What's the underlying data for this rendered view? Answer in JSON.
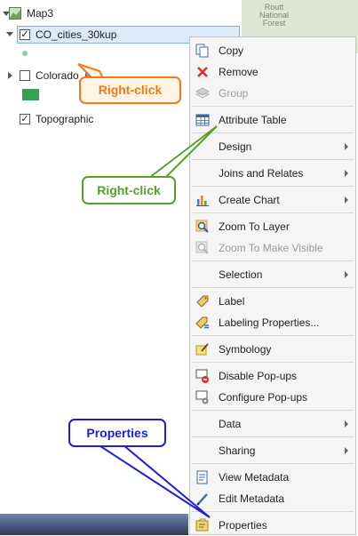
{
  "contents": {
    "map_name": "Map3",
    "layers": [
      {
        "name": "CO_cities_30kup",
        "checked": true
      },
      {
        "name": "Colorado_R"
      },
      {
        "name": "Topographic",
        "checked": true
      }
    ],
    "colors": {
      "selection": "#dbeaf8",
      "point_symbol": "#8cd19e",
      "polygon_symbol": "#3a9f55"
    }
  },
  "basemap_label": "Routt\nNational\nForest",
  "context_menu": {
    "items": [
      {
        "label": "Copy",
        "icon": "copy-icon",
        "enabled": true
      },
      {
        "label": "Remove",
        "icon": "remove-icon",
        "enabled": true
      },
      {
        "label": "Group",
        "icon": "group-icon",
        "enabled": false
      },
      {
        "label": "Attribute Table",
        "icon": "table-icon",
        "enabled": true
      },
      {
        "label": "Design",
        "submenu": true
      },
      {
        "label": "Joins and Relates",
        "submenu": true
      },
      {
        "label": "Create Chart",
        "icon": "chart-icon",
        "submenu": true
      },
      {
        "label": "Zoom To Layer",
        "icon": "zoom-icon",
        "enabled": true
      },
      {
        "label": "Zoom To Make Visible",
        "icon": "zoom-visible-icon",
        "enabled": false
      },
      {
        "label": "Selection",
        "submenu": true
      },
      {
        "label": "Label",
        "icon": "label-icon",
        "enabled": true
      },
      {
        "label": "Labeling Properties...",
        "icon": "labeling-icon",
        "enabled": true
      },
      {
        "label": "Symbology",
        "icon": "symbology-icon",
        "enabled": true
      },
      {
        "label": "Disable Pop-ups",
        "icon": "popup-disable-icon",
        "enabled": true
      },
      {
        "label": "Configure Pop-ups",
        "icon": "popup-config-icon",
        "enabled": true
      },
      {
        "label": "Data",
        "submenu": true
      },
      {
        "label": "Sharing",
        "submenu": true
      },
      {
        "label": "View Metadata",
        "icon": "metadata-view-icon",
        "enabled": true
      },
      {
        "label": "Edit Metadata",
        "icon": "metadata-edit-icon",
        "enabled": true
      },
      {
        "label": "Properties",
        "icon": "properties-icon",
        "enabled": true
      }
    ]
  },
  "callouts": [
    {
      "text": "Right-click",
      "color": "#f07a1a",
      "fill": "#fff3e2"
    },
    {
      "text": "Right-click",
      "color": "#5a9e2e",
      "fill": "#ffffff"
    },
    {
      "text": "Properties",
      "color": "#1e1ed8",
      "fill": "#ffffff"
    }
  ]
}
